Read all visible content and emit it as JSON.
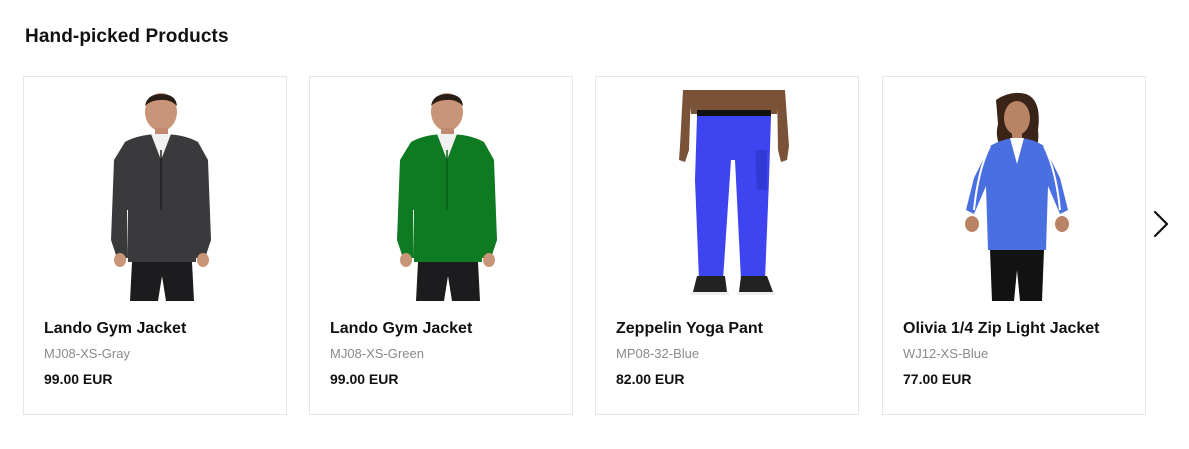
{
  "section": {
    "title": "Hand-picked Products"
  },
  "products": [
    {
      "name": "Lando Gym Jacket",
      "sku": "MJ08-XS-Gray",
      "price": "99.00 EUR",
      "image_icon": "gray-fleece-jacket-man-photo",
      "garment_color": "#3a3a3c"
    },
    {
      "name": "Lando Gym Jacket",
      "sku": "MJ08-XS-Green",
      "price": "99.00 EUR",
      "image_icon": "green-fleece-jacket-man-photo",
      "garment_color": "#0e7a22"
    },
    {
      "name": "Zeppelin Yoga Pant",
      "sku": "MP08-32-Blue",
      "price": "82.00 EUR",
      "image_icon": "blue-yoga-pant-photo",
      "garment_color": "#3d44f0"
    },
    {
      "name": "Olivia 1/4 Zip Light Jacket",
      "sku": "WJ12-XS-Blue",
      "price": "77.00 EUR",
      "image_icon": "blue-zip-jacket-woman-photo",
      "garment_color": "#4a6fe0"
    }
  ],
  "carousel": {
    "next_icon": "chevron-right-icon"
  }
}
